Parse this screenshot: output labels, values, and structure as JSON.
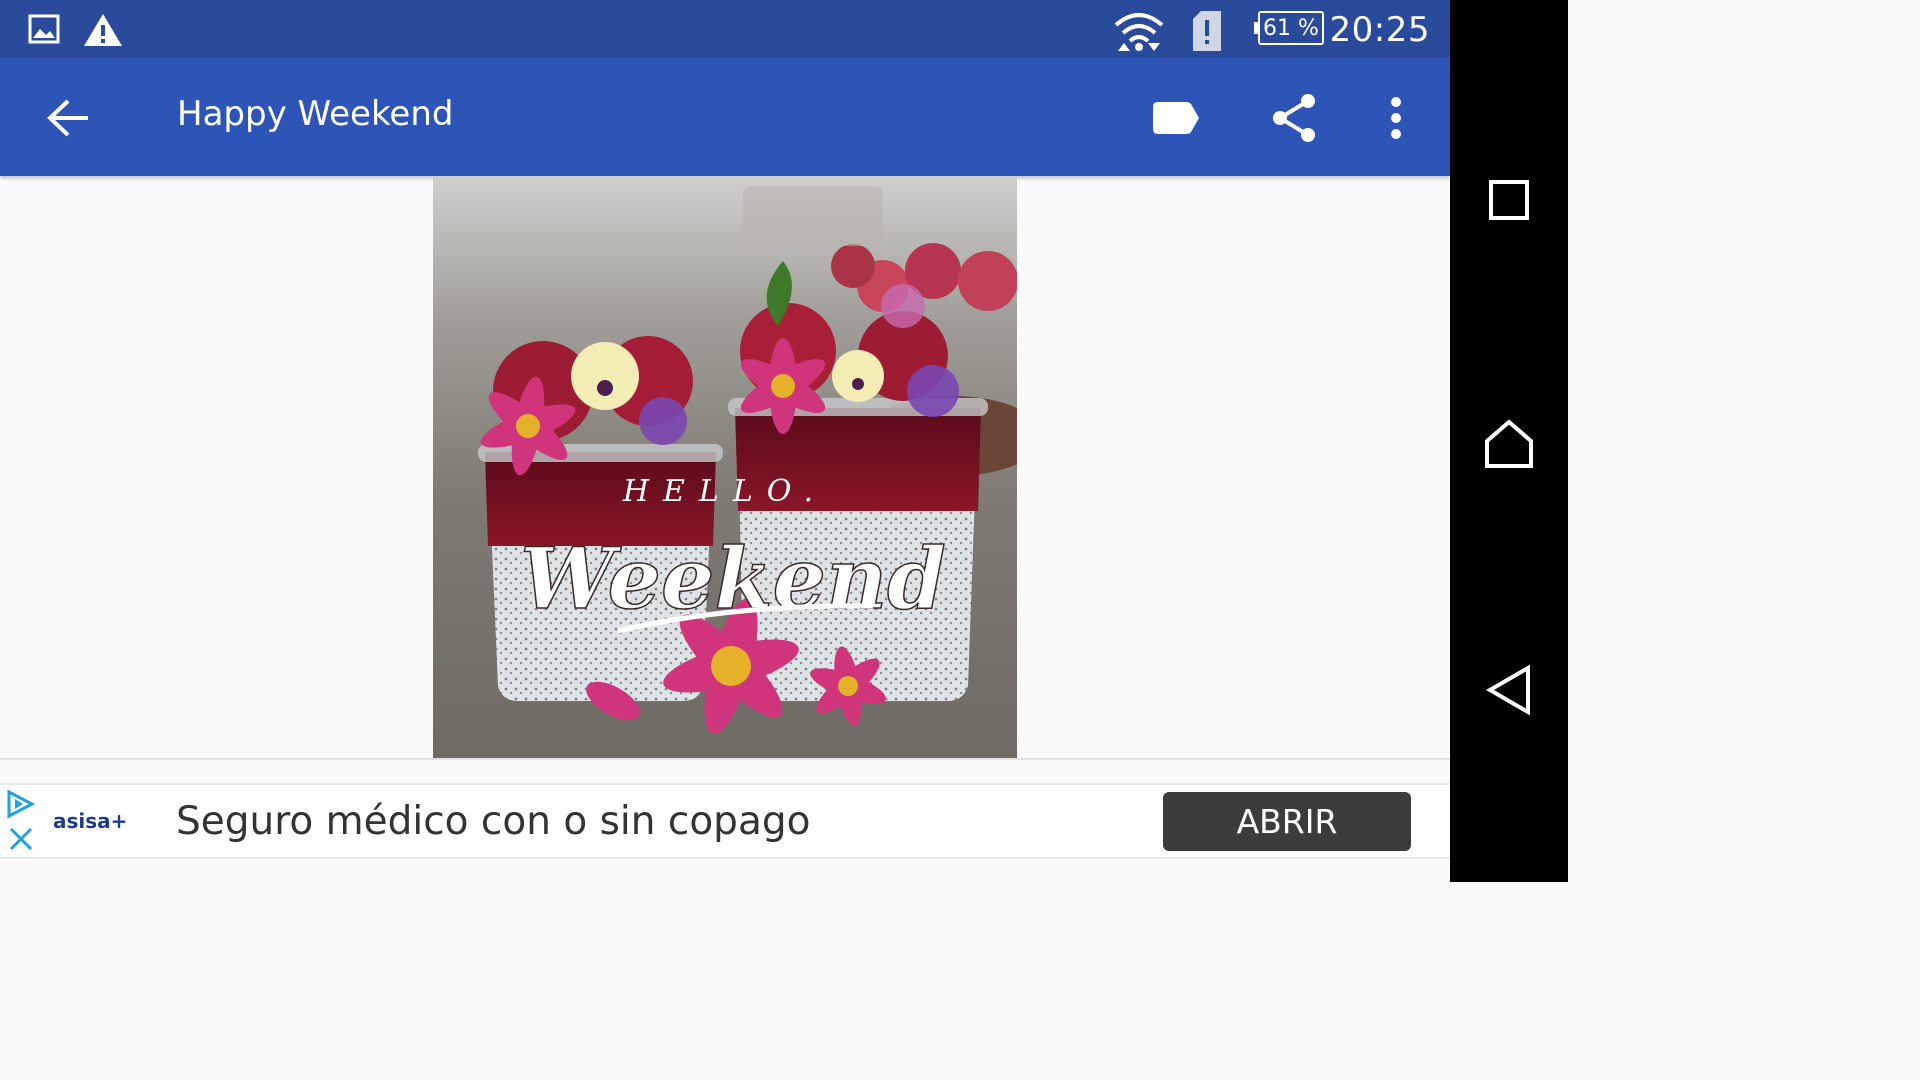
{
  "status_bar": {
    "time": "20:25",
    "battery": "61 %",
    "icons": [
      "image-icon",
      "warning-icon",
      "wifi-icon",
      "sim-alert-icon",
      "battery-icon"
    ]
  },
  "app_bar": {
    "title": "Happy Weekend",
    "icons": [
      "back-arrow-icon",
      "label-icon",
      "share-icon",
      "more-vert-icon"
    ]
  },
  "image": {
    "overlay_line1": "HELLO.",
    "overlay_line2": "Weekend"
  },
  "ad": {
    "brand": "asisa+",
    "text": "Seguro médico con o sin copago",
    "button": "ABRIR",
    "icons": [
      "adchoices-icon",
      "close-icon"
    ]
  },
  "nav_bar": {
    "icons": [
      "recents-icon",
      "home-icon",
      "back-icon"
    ]
  },
  "colors": {
    "status_bar": "#2a4a9c",
    "app_bar": "#2d55b8",
    "ad_button": "#3c3c3c"
  }
}
